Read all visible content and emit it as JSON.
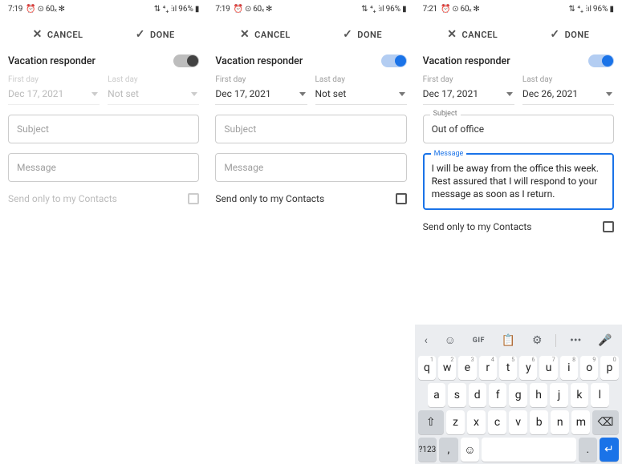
{
  "status": {
    "time_a": "7:19",
    "time_b": "7:19",
    "time_c": "7:21",
    "icons": "⏰ ⊙ 60ₓ ✻",
    "right_signal": "⇅ ⁴₊ ⫶ıl",
    "battery": "96%"
  },
  "topbar": {
    "cancel": "CANCEL",
    "done": "DONE"
  },
  "header": {
    "title": "Vacation responder"
  },
  "dates": {
    "first_label": "First day",
    "last_label": "Last day",
    "first_value": "Dec 17, 2021",
    "last_notset": "Not set",
    "last_value_c": "Dec 26, 2021"
  },
  "fields": {
    "subject_placeholder": "Subject",
    "subject_label": "Subject",
    "subject_value": "Out of office",
    "message_placeholder": "Message",
    "message_label": "Message",
    "message_value": "I will be away from the office this week. Rest assured that I will respond to your message as soon as I return."
  },
  "send_only": "Send only to my Contacts",
  "keyboard": {
    "top": {
      "back": "‹",
      "sticker": "☺",
      "gif": "GIF",
      "clip": "📋",
      "gear": "⚙",
      "more": "•••",
      "mic": "🎤"
    },
    "row1": [
      {
        "k": "q",
        "h": "1"
      },
      {
        "k": "w",
        "h": "2"
      },
      {
        "k": "e",
        "h": "3"
      },
      {
        "k": "r",
        "h": "4"
      },
      {
        "k": "t",
        "h": "5"
      },
      {
        "k": "y",
        "h": "6"
      },
      {
        "k": "u",
        "h": "7"
      },
      {
        "k": "i",
        "h": "8"
      },
      {
        "k": "o",
        "h": "9"
      },
      {
        "k": "p",
        "h": "0"
      }
    ],
    "row2": [
      "a",
      "s",
      "d",
      "f",
      "g",
      "h",
      "j",
      "k",
      "l"
    ],
    "row3": {
      "shift": "⇧",
      "keys": [
        "z",
        "x",
        "c",
        "v",
        "b",
        "n",
        "m"
      ],
      "bksp": "⌫"
    },
    "row4": {
      "numsym": "?123",
      "comma": ",",
      "emoji": "☺",
      "period": ".",
      "enter": "↵"
    }
  }
}
